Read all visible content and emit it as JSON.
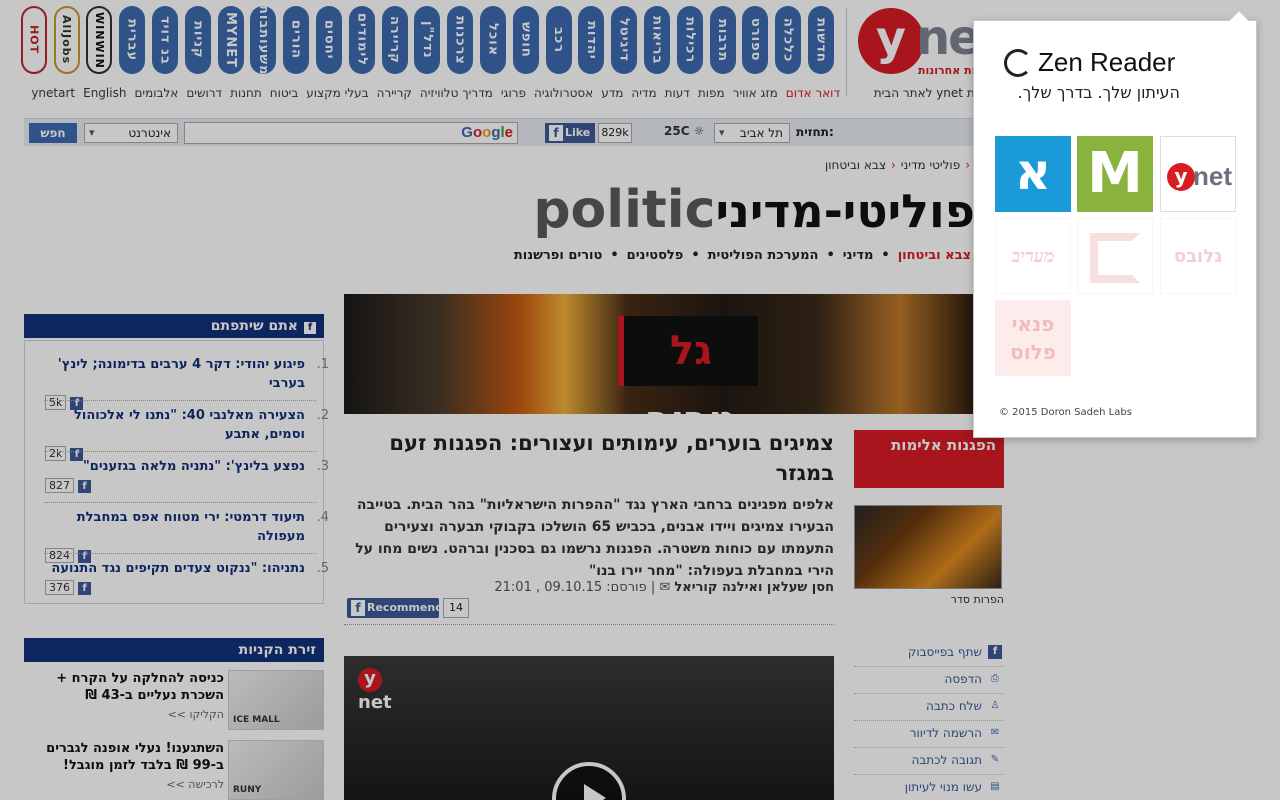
{
  "nav": {
    "pills": [
      "חדשות",
      "כלכלה",
      "ספורט",
      "תרבות",
      "רכילות",
      "בריאות",
      "דיגיטל",
      "יהדות",
      "רכב",
      "חופש",
      "אוכל",
      "צרכנות",
      "נדל\"ן",
      "קריירה",
      "לימודים",
      "יחסים",
      "הורים",
      "משעותבות",
      "MYNET",
      "קניות",
      "בנ דויד",
      "עברית",
      "WINWIN",
      "AllJobs",
      "HOT"
    ],
    "sublinks": [
      "דואר אדום",
      "מזג אוויר",
      "מפות",
      "דעות",
      "מדיה",
      "מדע",
      "אסטרולוגיה",
      "פרוגי",
      "מדריך טלוויזיה",
      "קריירה",
      "בעלי מקצוע",
      "ביטוח",
      "תחנות",
      "דרושים",
      "אלבומים",
      "ynetart",
      "English"
    ],
    "sublinks_right": "הכו את ynet לאתר הבית"
  },
  "logo": {
    "letter": "y",
    "suffix": "net",
    "tagline": "ידיעות אחרונות"
  },
  "toolbar": {
    "search_button": "חפש",
    "search_scope": "אינטרנט",
    "google_label": "Google",
    "like_label": "Like",
    "like_count": "829k",
    "temperature": "25C",
    "city": "תל אביב",
    "forecast_label": "תחזית:"
  },
  "breadcrumb": {
    "items": [
      "פוליטי מדיני",
      "צבא וביטחון"
    ]
  },
  "section": {
    "title_he": "פוליטי-מדיני",
    "title_en": "politic",
    "nav": [
      "צבא וביטחון",
      "מדיני",
      "המערכת הפוליטית",
      "פלסטינים",
      "טורים ופרשנות"
    ]
  },
  "hero": {
    "badge_prefix": "גל",
    "badge_word": "טרור"
  },
  "article": {
    "title": "צמיגים בוערים, עימותים ועצורים: הפגנות זעם במגזר",
    "subtitle": "אלפים מפגינים ברחבי הארץ נגד \"ההפרות הישראליות\" בהר הבית. בטייבה הבעירו צמיגים ויידו אבנים, בכביש 65 הושלכו בקבוקי תבערה וצעירים התעמתו עם כוחות משטרה. הפגנות נרשמו גם בסכנין וברהט. נשים מחו על הירי במחבלת בעפולה: \"מחר יירו בנו\"",
    "authors": "חסן שעלאן ואילנה קוריאל",
    "published_label": "פורסם:",
    "date": "09.10.15 , 21:01",
    "recommend_label": "Recommend",
    "recommend_count": "14"
  },
  "sidebar": {
    "red_box": "הפגנות אלימות",
    "thumb_caption": "הפרות סדר",
    "tools": [
      {
        "label": "שתף בפייסבוק",
        "icon": "facebook-icon",
        "glyph": "f"
      },
      {
        "label": "הדפסה",
        "icon": "print-icon",
        "glyph": "⎙"
      },
      {
        "label": "שלח כתבה",
        "icon": "person-icon",
        "glyph": "♙"
      },
      {
        "label": "הרשמה לדיוור",
        "icon": "mail-icon",
        "glyph": "✉"
      },
      {
        "label": "תגובה לכתבה",
        "icon": "comment-icon",
        "glyph": "✎"
      },
      {
        "label": "עשו מנוי לעיתון",
        "icon": "newspaper-icon",
        "glyph": "▤"
      }
    ]
  },
  "share": {
    "header": "אתם שיתפתם",
    "items": [
      {
        "num": "1.",
        "text": "פיגוע יהודי: דקר 4 ערבים בדימונה; לינץ' בערבי",
        "count": "5k"
      },
      {
        "num": "2.",
        "text": "הצעירה מאלנבי 40: \"נתנו לי אלכוהול וסמים, אתבע",
        "count": "2k"
      },
      {
        "num": "3.",
        "text": "נפצע בלינץ': \"נתניה מלאה בגזענים\"",
        "count": "827"
      },
      {
        "num": "4.",
        "text": "תיעוד דרמטי: ירי מטווח אפס במחבלת מעפולה",
        "count": "824"
      },
      {
        "num": "5.",
        "text": "נתניהו: \"ננקוט צעדים תקיפים נגד התנועה",
        "count": "376"
      }
    ]
  },
  "shopping": {
    "header": "זירת הקניות",
    "items": [
      {
        "text": "כניסה להחלקה על הקרח + השכרת נעליים ב-43 ₪",
        "link": "הקליקו >>",
        "brand": "ICE MALL"
      },
      {
        "text": "השתגענו! נעלי אופנה לגברים ב-99 ₪ בלבד לזמן מוגבל!",
        "link": "לרכישה >>",
        "brand": "RUNY"
      }
    ]
  },
  "video": {
    "logo": "ynet"
  },
  "zen": {
    "title": "Zen Reader",
    "tagline": "העיתון שלך. בדרך שלך.",
    "copyright": "© 2015 Doron Sadeh Labs",
    "sites": {
      "ynet_prefix": "y",
      "ynet_suffix": "net",
      "mako": "M",
      "haaretz": "א",
      "globes": "גלובס",
      "maariv": "מעריב",
      "panai": "פנאי פלוס"
    }
  }
}
